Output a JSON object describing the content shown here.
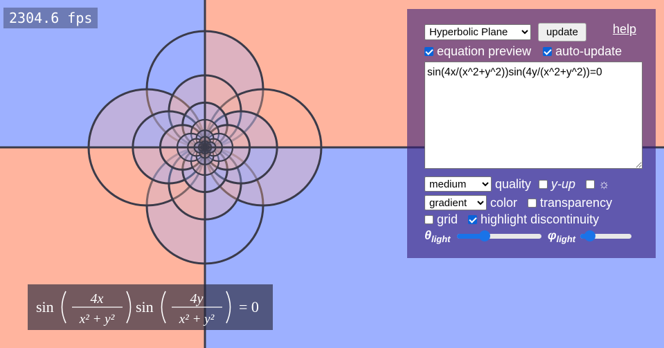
{
  "fps": {
    "text": "2304.6 fps"
  },
  "panel": {
    "mode_select": {
      "selected": "Hyperbolic Plane"
    },
    "update_label": "update",
    "help_label": "help",
    "equation_preview": {
      "label": "equation preview",
      "checked": true
    },
    "auto_update": {
      "label": "auto-update",
      "checked": true
    },
    "equation": "sin(4x/(x^2+y^2))sin(4y/(x^2+y^2))=0",
    "quality": {
      "selected": "medium",
      "label": "quality"
    },
    "y_up": {
      "label": "y-up",
      "checked": false
    },
    "light_toggle": {
      "icon": "sun-icon",
      "checked": false
    },
    "color": {
      "selected": "gradient",
      "label": "color"
    },
    "transparency": {
      "label": "transparency",
      "checked": false
    },
    "grid": {
      "label": "grid",
      "checked": false
    },
    "highlight": {
      "label": "highlight discontinuity",
      "checked": true
    },
    "theta_light": {
      "symbol": "θ",
      "sub": "light",
      "value": 0.3
    },
    "phi_light": {
      "symbol": "φ",
      "sub": "light",
      "value": 0.1
    }
  },
  "formula": {
    "sin1": "sin",
    "num1": "4x",
    "den1": "x² + y²",
    "sin2": "sin",
    "num2": "4y",
    "den2": "x² + y²",
    "rhs": "= 0"
  },
  "colors": {
    "blue": "#9db0ff",
    "salmon": "#ffb49e",
    "curve": "#3b3b4a",
    "accent": "#1a73e8"
  }
}
